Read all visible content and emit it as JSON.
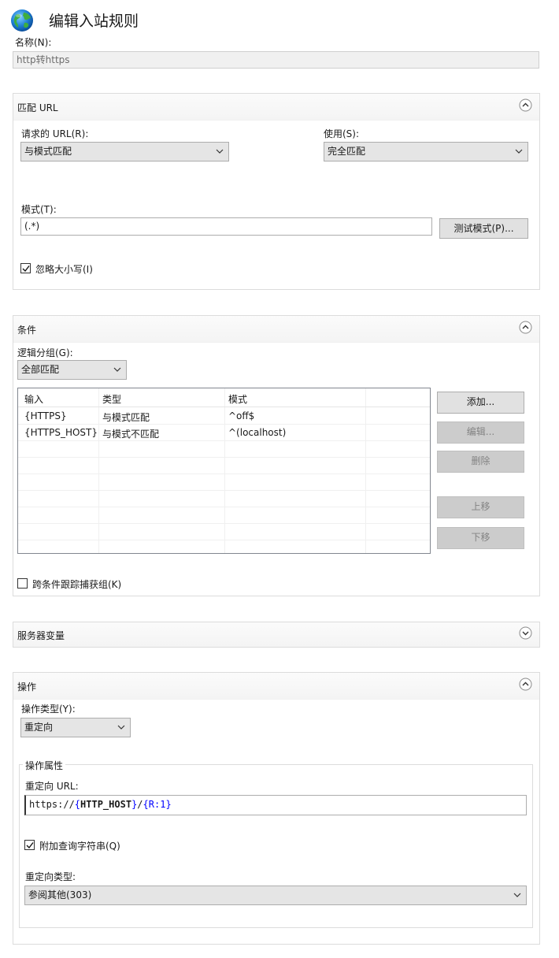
{
  "header": {
    "title": "编辑入站规则"
  },
  "name": {
    "label": "名称(N):",
    "value": "http转https"
  },
  "match_url": {
    "title": "匹配 URL",
    "requested_url_label": "请求的 URL(R):",
    "requested_url_value": "与模式匹配",
    "using_label": "使用(S):",
    "using_value": "完全匹配",
    "pattern_label": "模式(T):",
    "pattern_value": "(.*)",
    "test_button": "测试模式(P)...",
    "ignore_case_label": "忽略大小写(I)",
    "ignore_case_checked": true
  },
  "conditions": {
    "title": "条件",
    "logical_grouping_label": "逻辑分组(G):",
    "logical_grouping_value": "全部匹配",
    "columns": [
      "输入",
      "类型",
      "模式"
    ],
    "rows": [
      {
        "input": "{HTTPS}",
        "type": "与模式匹配",
        "pattern": "^off$"
      },
      {
        "input": "{HTTPS_HOST}",
        "type": "与模式不匹配",
        "pattern": "^(localhost)"
      }
    ],
    "buttons": {
      "add": "添加...",
      "edit": "编辑...",
      "remove": "删除",
      "move_up": "上移",
      "move_down": "下移"
    },
    "track_groups_label": "跨条件跟踪捕获组(K)",
    "track_groups_checked": false
  },
  "server_variables": {
    "title": "服务器变量"
  },
  "action": {
    "title": "操作",
    "action_type_label": "操作类型(Y):",
    "action_type_value": "重定向",
    "properties_legend": "操作属性",
    "redirect_url_label": "重定向 URL:",
    "redirect_url_tokens": [
      "https://",
      "{",
      "HTTP_HOST",
      "}",
      "/",
      "{",
      "R:1",
      "}"
    ],
    "append_query_label": "附加查询字符串(Q)",
    "append_query_checked": true,
    "redirect_type_label": "重定向类型:",
    "redirect_type_value": "参阅其他(303)"
  },
  "colors": {
    "panel_border": "#dcdcdc",
    "button_bg": "#e1e1e1",
    "disabled_bg": "#cccccc",
    "accent_blue": "#0000ff"
  },
  "icons": [
    "globe-icon",
    "collapse-up-icon",
    "expand-down-icon",
    "chevron-down-icon",
    "checkmark-icon"
  ]
}
